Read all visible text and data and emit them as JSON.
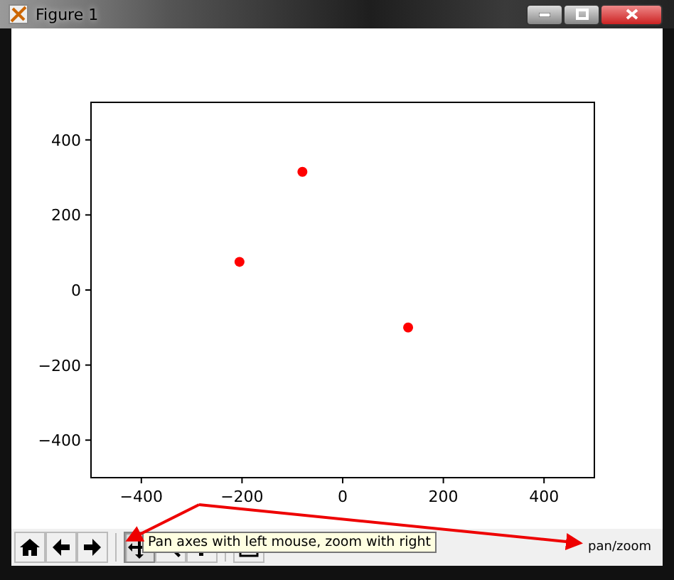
{
  "window": {
    "title": "Figure 1"
  },
  "figure": {
    "chart_data": {
      "type": "scatter",
      "xlim": [
        -500,
        500
      ],
      "ylim": [
        -500,
        500
      ],
      "xticks": [
        {
          "value": -400,
          "label": "−400"
        },
        {
          "value": -200,
          "label": "−200"
        },
        {
          "value": 0,
          "label": "0"
        },
        {
          "value": 200,
          "label": "200"
        },
        {
          "value": 400,
          "label": "400"
        }
      ],
      "yticks": [
        {
          "value": -400,
          "label": "−400"
        },
        {
          "value": -200,
          "label": "−200"
        },
        {
          "value": 0,
          "label": "0"
        },
        {
          "value": 200,
          "label": "200"
        },
        {
          "value": 400,
          "label": "400"
        }
      ],
      "x": [
        -80,
        -205,
        130
      ],
      "series": [
        {
          "color": "#ff0000",
          "values": [
            315,
            75,
            -100
          ]
        }
      ]
    }
  },
  "toolbar": {
    "tools": [
      {
        "kind": "home",
        "selected": false
      },
      {
        "kind": "back",
        "selected": false
      },
      {
        "kind": "forward",
        "selected": false
      },
      {
        "kind": "pan",
        "selected": true
      },
      {
        "kind": "zoom",
        "selected": false
      },
      {
        "kind": "subplots",
        "selected": false
      },
      {
        "kind": "save",
        "selected": false
      }
    ],
    "tooltip": "Pan axes with left mouse, zoom with right",
    "status": "pan/zoom"
  }
}
